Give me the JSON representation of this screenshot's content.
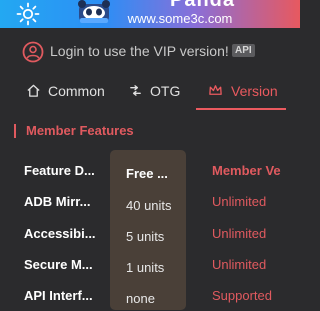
{
  "header": {
    "brand": "Panda",
    "site": "www.some3c.com"
  },
  "login": {
    "text": "Login to use the VIP version!",
    "badge": "API"
  },
  "tabs": [
    {
      "label": "Common",
      "icon": "home-icon"
    },
    {
      "label": "OTG",
      "icon": "otg-icon"
    },
    {
      "label": "Version",
      "icon": "crown-icon",
      "active": true
    }
  ],
  "section": {
    "title": "Member Features"
  },
  "table": {
    "headers": [
      "Feature D...",
      "Free ...",
      "Member Ve"
    ],
    "rows": [
      {
        "feature": "ADB Mirr...",
        "free": "40 units",
        "member": "Unlimited"
      },
      {
        "feature": "Accessibi...",
        "free": "5 units",
        "member": "Unlimited"
      },
      {
        "feature": "Secure M...",
        "free": "1 units",
        "member": "Unlimited"
      },
      {
        "feature": "API Interf...",
        "free": "none",
        "member": "Supported"
      }
    ]
  },
  "colors": {
    "accent": "#ea5a5f",
    "background": "#2b2b2d",
    "free_column": "#4a4038"
  }
}
